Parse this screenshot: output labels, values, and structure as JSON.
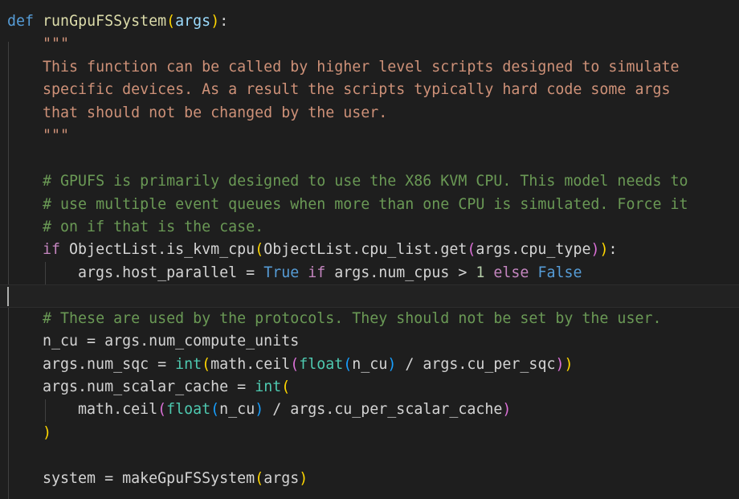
{
  "editor": {
    "lines": [
      [
        [
          "kw",
          "def"
        ],
        [
          "plain",
          " "
        ],
        [
          "fn",
          "runGpuFSSystem"
        ],
        [
          "br1",
          "("
        ],
        [
          "var",
          "args"
        ],
        [
          "br1",
          ")"
        ],
        [
          "plain",
          ":"
        ]
      ],
      [
        [
          "plain",
          "    "
        ],
        [
          "str",
          "\"\"\""
        ]
      ],
      [
        [
          "plain",
          "    "
        ],
        [
          "str",
          "This function can be called by higher level scripts designed to simulate"
        ]
      ],
      [
        [
          "plain",
          "    "
        ],
        [
          "str",
          "specific devices. As a result the scripts typically hard code some args"
        ]
      ],
      [
        [
          "plain",
          "    "
        ],
        [
          "str",
          "that should not be changed by the user."
        ]
      ],
      [
        [
          "plain",
          "    "
        ],
        [
          "str",
          "\"\"\""
        ]
      ],
      [],
      [
        [
          "plain",
          "    "
        ],
        [
          "cmt",
          "# GPUFS is primarily designed to use the X86 KVM CPU. This model needs to"
        ]
      ],
      [
        [
          "plain",
          "    "
        ],
        [
          "cmt",
          "# use multiple event queues when more than one CPU is simulated. Force it"
        ]
      ],
      [
        [
          "plain",
          "    "
        ],
        [
          "cmt",
          "# on if that is the case."
        ]
      ],
      [
        [
          "plain",
          "    "
        ],
        [
          "ctl",
          "if"
        ],
        [
          "plain",
          " ObjectList.is_kvm_cpu"
        ],
        [
          "br1",
          "("
        ],
        [
          "plain",
          "ObjectList.cpu_list.get"
        ],
        [
          "br2",
          "("
        ],
        [
          "plain",
          "args.cpu_type"
        ],
        [
          "br2",
          ")"
        ],
        [
          "br1",
          ")"
        ],
        [
          "plain",
          ":"
        ]
      ],
      [
        [
          "plain",
          "        args.host_parallel = "
        ],
        [
          "kw",
          "True"
        ],
        [
          "plain",
          " "
        ],
        [
          "ctl",
          "if"
        ],
        [
          "plain",
          " args.num_cpus > "
        ],
        [
          "num",
          "1"
        ],
        [
          "plain",
          " "
        ],
        [
          "ctl",
          "else"
        ],
        [
          "plain",
          " "
        ],
        [
          "kw",
          "False"
        ]
      ],
      [],
      [
        [
          "plain",
          "    "
        ],
        [
          "cmt",
          "# These are used by the protocols. They should not be set by the user."
        ]
      ],
      [
        [
          "plain",
          "    n_cu = args.num_compute_units"
        ]
      ],
      [
        [
          "plain",
          "    args.num_sqc = "
        ],
        [
          "cls",
          "int"
        ],
        [
          "br1",
          "("
        ],
        [
          "plain",
          "math.ceil"
        ],
        [
          "br2",
          "("
        ],
        [
          "cls",
          "float"
        ],
        [
          "br3",
          "("
        ],
        [
          "plain",
          "n_cu"
        ],
        [
          "br3",
          ")"
        ],
        [
          "plain",
          " / args.cu_per_sqc"
        ],
        [
          "br2",
          ")"
        ],
        [
          "br1",
          ")"
        ]
      ],
      [
        [
          "plain",
          "    args.num_scalar_cache = "
        ],
        [
          "cls",
          "int"
        ],
        [
          "br1",
          "("
        ]
      ],
      [
        [
          "plain",
          "        math.ceil"
        ],
        [
          "br2",
          "("
        ],
        [
          "cls",
          "float"
        ],
        [
          "br3",
          "("
        ],
        [
          "plain",
          "n_cu"
        ],
        [
          "br3",
          ")"
        ],
        [
          "plain",
          " / args.cu_per_scalar_cache"
        ],
        [
          "br2",
          ")"
        ]
      ],
      [
        [
          "plain",
          "    "
        ],
        [
          "br1",
          ")"
        ]
      ],
      [],
      [
        [
          "plain",
          "    system = makeGpuFSSystem"
        ],
        [
          "br1",
          "("
        ],
        [
          "plain",
          "args"
        ],
        [
          "br1",
          ")"
        ]
      ]
    ],
    "current_line": 12
  },
  "colors": {
    "background": "#1e1e1e",
    "keyword": "#569cd6",
    "control": "#c586c0",
    "function": "#dcdcaa",
    "string": "#ce9178",
    "comment": "#6a9955",
    "number": "#b5cea8",
    "builtin": "#4ec9b0"
  }
}
